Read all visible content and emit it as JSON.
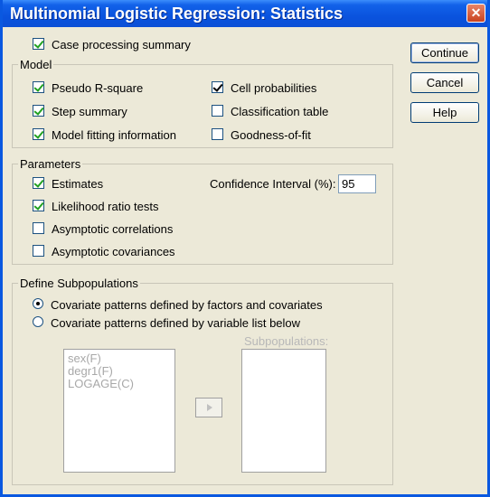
{
  "window": {
    "title": "Multinomial Logistic Regression: Statistics"
  },
  "case_processing": {
    "label": "Case processing summary",
    "checked": true
  },
  "model": {
    "legend": "Model",
    "pseudo_r_square": {
      "label": "Pseudo R-square",
      "checked": true
    },
    "step_summary": {
      "label": "Step summary",
      "checked": true
    },
    "model_fitting": {
      "label": "Model fitting information",
      "checked": true
    },
    "cell_probabilities": {
      "label": "Cell probabilities",
      "checked": true
    },
    "classification_table": {
      "label": "Classification table",
      "checked": false
    },
    "goodness_of_fit": {
      "label": "Goodness-of-fit",
      "checked": false
    }
  },
  "parameters": {
    "legend": "Parameters",
    "estimates": {
      "label": "Estimates",
      "checked": true
    },
    "likelihood_ratio": {
      "label": "Likelihood ratio tests",
      "checked": true
    },
    "asymptotic_correlations": {
      "label": "Asymptotic correlations",
      "checked": false
    },
    "asymptotic_covariances": {
      "label": "Asymptotic covariances",
      "checked": false
    },
    "ci_label": "Confidence Interval (%):",
    "ci_value": "95"
  },
  "subpop": {
    "legend": "Define Subpopulations",
    "option1": "Covariate patterns defined by factors and covariates",
    "option2": "Covariate patterns defined by variable list below",
    "selected": 1,
    "variables": [
      "sex(F)",
      "degr1(F)",
      "LOGAGE(C)"
    ],
    "subpop_label": "Subpopulations:"
  },
  "buttons": {
    "continue": "Continue",
    "cancel": "Cancel",
    "help": "Help"
  },
  "colors": {
    "title_bar": "#0a53de",
    "dialog_bg": "#ece9d8",
    "check_mark": "#21a121"
  }
}
